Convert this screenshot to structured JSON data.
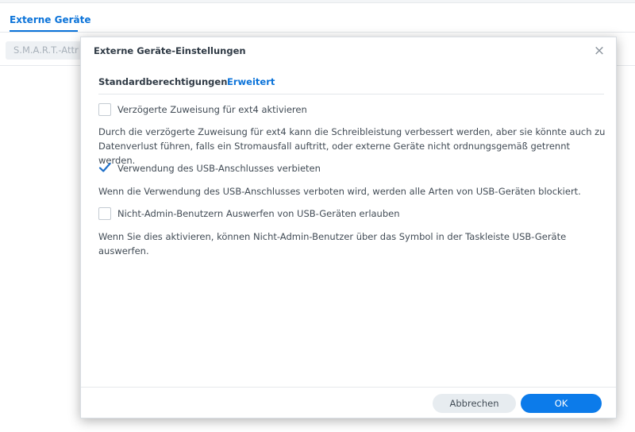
{
  "background": {
    "tab_label": "Externe Geräte",
    "button_label": "S.M.A.R.T.-Attr"
  },
  "dialog": {
    "title": "Externe Geräte-Einstellungen",
    "close_symbol": "×",
    "tabs": [
      {
        "label": "Standardberechtigungen",
        "active": false
      },
      {
        "label": "Erweitert",
        "active": true
      }
    ],
    "options": [
      {
        "label": "Verzögerte Zuweisung für ext4 aktivieren",
        "checked": false,
        "description": "Durch die verzögerte Zuweisung für ext4 kann die Schreibleistung verbessert werden, aber sie könnte auch zu Datenverlust führen, falls ein Stromausfall auftritt, oder externe Geräte nicht ordnungsgemäß getrennt werden."
      },
      {
        "label": "Verwendung des USB-Anschlusses verbieten",
        "checked": true,
        "description": "Wenn die Verwendung des USB-Anschlusses verboten wird, werden alle Arten von USB-Geräten blockiert."
      },
      {
        "label": "Nicht-Admin-Benutzern Auswerfen von USB-Geräten erlauben",
        "checked": false,
        "description": "Wenn Sie dies aktivieren, können Nicht-Admin-Benutzer über das Symbol in der Taskleiste USB-Geräte auswerfen."
      }
    ],
    "buttons": {
      "cancel": "Abbrechen",
      "ok": "OK"
    }
  },
  "colors": {
    "accent": "#0b73d9",
    "ok_button": "#0c7bea",
    "cancel_button": "#e7ecf0",
    "checkmark": "#1e6fc8"
  }
}
